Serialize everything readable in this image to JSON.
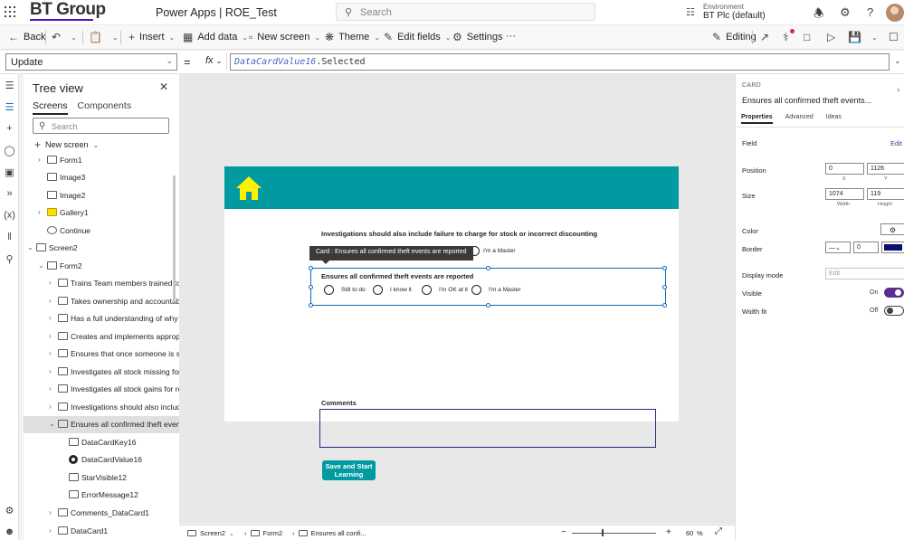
{
  "header": {
    "brand": "BT Group",
    "app_name": "Power Apps  |  ROE_Test",
    "search_placeholder": "Search",
    "environment_label": "Environment",
    "environment_value": "BT Plc (default)"
  },
  "toolbar": {
    "back": "Back",
    "insert": "Insert",
    "add_data": "Add data",
    "new_screen": "New screen",
    "theme": "Theme",
    "edit_fields": "Edit fields",
    "settings": "Settings",
    "more": "···",
    "editing": "Editing"
  },
  "formula_bar": {
    "property": "Update",
    "eq": "=",
    "fx": "fx",
    "formula_part1": "DataCardValue16",
    "formula_part2": ".Selected"
  },
  "tree": {
    "title": "Tree view",
    "tabs": [
      "Screens",
      "Components"
    ],
    "search_placeholder": "Search",
    "new_screen": "New screen",
    "items": [
      {
        "label": "Form1"
      },
      {
        "label": "Image3"
      },
      {
        "label": "Image2"
      },
      {
        "label": "Gallery1"
      },
      {
        "label": "Continue"
      },
      {
        "label": "Screen2"
      },
      {
        "label": "Form2"
      },
      {
        "label": "Trains Team members trained to und"
      },
      {
        "label": "Takes ownership and accountability c"
      },
      {
        "label": "Has a full understanding of why varia"
      },
      {
        "label": "Creates and implements appropriate"
      },
      {
        "label": "Ensures that once someone is signed"
      },
      {
        "label": "Investigates all stock missing for inte"
      },
      {
        "label": "Investigates all stock gains for return"
      },
      {
        "label": "Investigations should also include fai"
      },
      {
        "label": "Ensures all confirmed theft events are"
      },
      {
        "label": "DataCardKey16"
      },
      {
        "label": "DataCardValue16"
      },
      {
        "label": "StarVisible12"
      },
      {
        "label": "ErrorMessage12"
      },
      {
        "label": "Comments_DataCard1"
      },
      {
        "label": "DataCard1"
      }
    ]
  },
  "canvas": {
    "question_prev": "Investigations should also include failure to charge for stock or incorrect discounting",
    "master_prev": "I'm a Master",
    "tooltip": "Card : Ensures all confirmed theft events are reported",
    "card_title": "Ensures all confirmed theft events are reported",
    "options": [
      "Still to do",
      "I know it",
      "I'm OK at it",
      "I'm a Master"
    ],
    "comments_label": "Comments",
    "save_button": "Save and Start Learning"
  },
  "statusbar": {
    "crumb1": "Screen2",
    "crumb2": "Form2",
    "crumb3": "Ensures all confi...",
    "zoom_minus": "−",
    "zoom_plus": "+",
    "zoom_value": "60",
    "zoom_unit": "%"
  },
  "properties": {
    "section": "CARD",
    "name": "Ensures all confirmed theft events...",
    "tabs": [
      "Properties",
      "Advanced",
      "Ideas"
    ],
    "field_label": "Field",
    "field_edit": "Edit",
    "position_label": "Position",
    "position_x": "0",
    "position_y": "1126",
    "x_caption": "X",
    "y_caption": "Y",
    "size_label": "Size",
    "width": "1074",
    "height": "119",
    "width_caption": "Width",
    "height_caption": "Height",
    "color_label": "Color",
    "border_label": "Border",
    "border_width": "0",
    "border_color": "#0b0f6e",
    "display_mode_label": "Display mode",
    "display_mode_value": "Edit",
    "visible_label": "Visible",
    "visible_state": "On",
    "width_fit_label": "Width fit",
    "width_fit_state": "Off"
  },
  "colors": {
    "accent": "#009aa0",
    "selection": "#0f6cbd",
    "toggle_on": "#5b2d90"
  }
}
